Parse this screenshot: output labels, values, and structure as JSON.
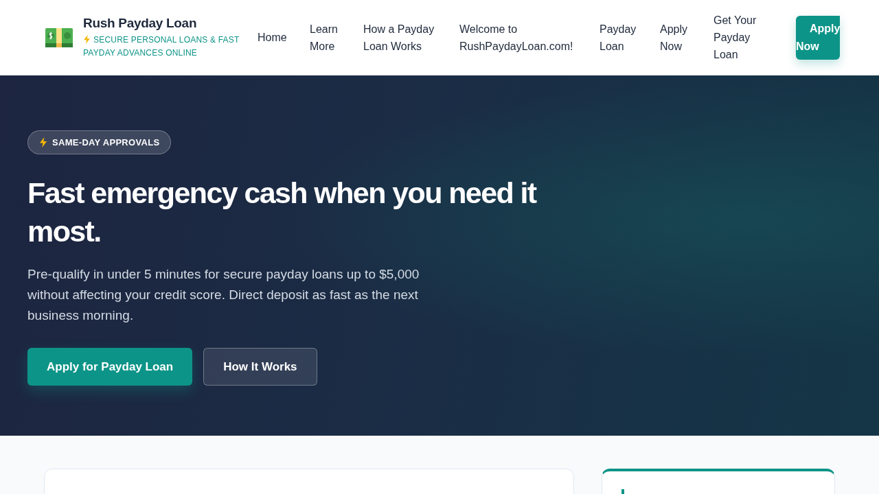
{
  "header": {
    "brand": {
      "name": "Rush Payday Loan",
      "tagline": "SECURE PERSONAL LOANS & FAST PAYDAY ADVANCES ONLINE"
    },
    "nav": [
      {
        "label": "Home"
      },
      {
        "label": "Learn More"
      },
      {
        "label": "How a Payday Loan Works"
      },
      {
        "label": "Welcome to RushPaydayLoan.com!"
      },
      {
        "label": "Payday Loan"
      },
      {
        "label": "Apply Now"
      },
      {
        "label": "Get Your Payday Loan"
      }
    ],
    "cta": "Apply Now"
  },
  "hero": {
    "badge": "SAME-DAY APPROVALS",
    "title": "Fast emergency cash when you need it most.",
    "text": "Pre-qualify in under 5 minutes for secure payday loans up to $5,000 without affecting your credit score. Direct deposit as fast as the next business morning.",
    "buttons": [
      {
        "label": "Apply for Payday Loan",
        "kind": "primary"
      },
      {
        "label": "How It Works",
        "kind": "secondary"
      }
    ]
  }
}
